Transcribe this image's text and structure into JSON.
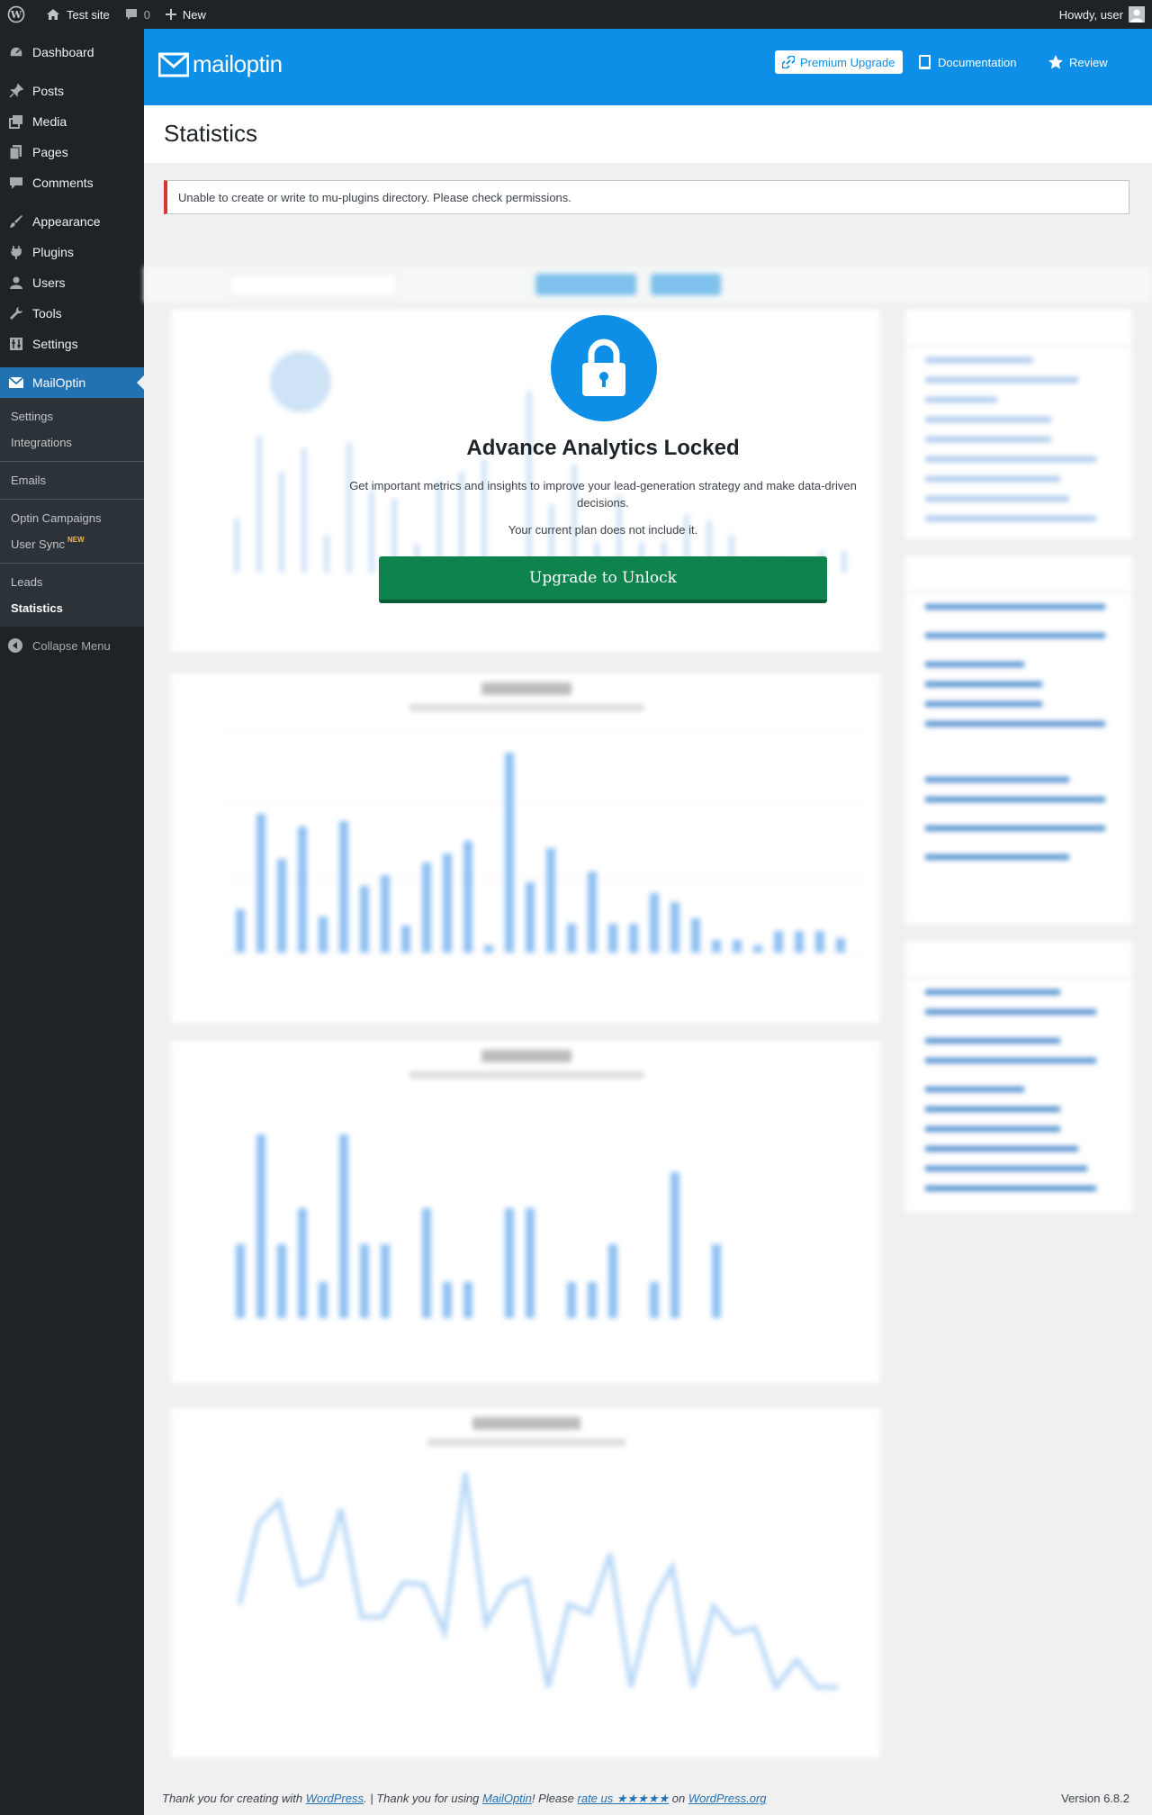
{
  "adminbar": {
    "site_name": "Test site",
    "comments_count": "0",
    "new_label": "New",
    "howdy": "Howdy, user"
  },
  "sidebar": {
    "items": [
      {
        "label": "Dashboard",
        "icon": "dashboard-icon"
      },
      {
        "label": "Posts",
        "icon": "pin-icon"
      },
      {
        "label": "Media",
        "icon": "media-icon"
      },
      {
        "label": "Pages",
        "icon": "pages-icon"
      },
      {
        "label": "Comments",
        "icon": "comment-icon"
      },
      {
        "label": "Appearance",
        "icon": "brush-icon"
      },
      {
        "label": "Plugins",
        "icon": "plug-icon"
      },
      {
        "label": "Users",
        "icon": "user-icon"
      },
      {
        "label": "Tools",
        "icon": "wrench-icon"
      },
      {
        "label": "Settings",
        "icon": "settings-icon"
      },
      {
        "label": "MailOptin",
        "icon": "mailoptin-icon"
      }
    ],
    "submenu": {
      "settings": "Settings",
      "integrations": "Integrations",
      "emails": "Emails",
      "optin_campaigns": "Optin Campaigns",
      "user_sync": "User Sync",
      "new_badge": "NEW",
      "leads": "Leads",
      "statistics": "Statistics"
    },
    "collapse": "Collapse Menu"
  },
  "header": {
    "logo_text": "mailoptin",
    "premium": "Premium Upgrade",
    "documentation": "Documentation",
    "review": "Review"
  },
  "page": {
    "title": "Statistics",
    "notice": "Unable to create or write to mu-plugins directory. Please check permissions."
  },
  "locked": {
    "title": "Advance Analytics Locked",
    "description": "Get important metrics and insights to improve your lead-generation strategy and make data-driven decisions.",
    "plan_note": "Your current plan does not include it.",
    "button": "Upgrade to Unlock"
  },
  "colors": {
    "brand": "#0d8ee7",
    "upgrade": "#0f834d",
    "sidebar": "#1d2327",
    "active": "#2271b1",
    "notice_error": "#d63638"
  },
  "footer": {
    "thanks_pre": "Thank you for creating with ",
    "wordpress": "WordPress",
    "thanks_mid": ". | Thank you for using ",
    "mailoptin": "MailOptin",
    "please": "! Please ",
    "rate": "rate us ★★★★★",
    "on": " on ",
    "wporg": "WordPress.org",
    "version": "Version 6.8.2"
  }
}
